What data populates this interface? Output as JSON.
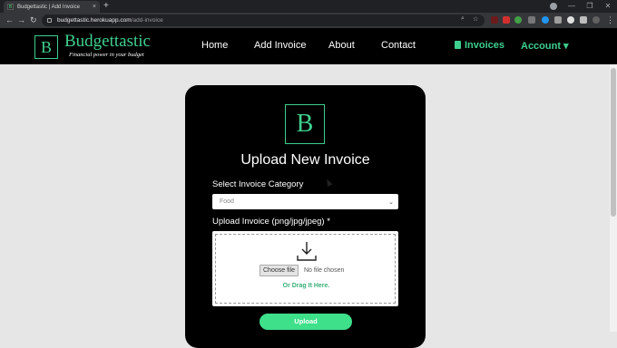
{
  "browser": {
    "tab_title": "Budgettastic | Add Invoice",
    "tab_close": "×",
    "new_tab": "+",
    "url_host": "budgettastic.herokuapp.com",
    "url_path": "/add-invoice",
    "back": "←",
    "forward": "→",
    "reload": "↻",
    "search_icon": "⌕",
    "star_icon": "☆",
    "minimize": "—",
    "maximize": "❐",
    "close": "✕",
    "menu": "⋮"
  },
  "header": {
    "logo_letter": "B",
    "brand_name": "Budgettastic",
    "brand_tagline": "Financial power in your budget",
    "nav": {
      "home": "Home",
      "add_invoice": "Add Invoice",
      "about": "About",
      "contact": "Contact",
      "invoices": "Invoices",
      "account": "Account ▾"
    }
  },
  "form": {
    "logo_letter": "B",
    "title": "Upload New Invoice",
    "category_label": "Select Invoice Category",
    "category_selected": "Food",
    "category_chevron": "⌄",
    "file_label": "Upload Invoice (png/jpg/jpeg) *",
    "choose_file": "Choose file",
    "no_file": "No file chosen",
    "drag_text": "Or Drag It Here.",
    "submit": "Upload"
  },
  "colors": {
    "accent": "#3ecf8e",
    "button": "#3ee08a",
    "header_bg": "#000000",
    "page_bg": "#e6e6e6"
  }
}
